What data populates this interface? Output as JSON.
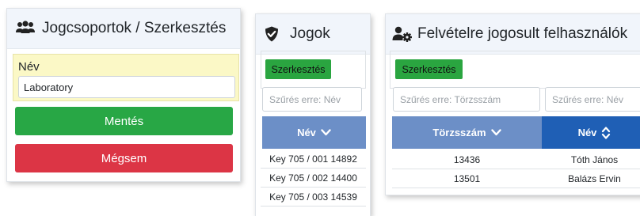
{
  "group_panel": {
    "title": "Jogcsoportok / Szerkesztés",
    "icon": "users-icon",
    "field_label": "Név",
    "field_value": "Laboratory",
    "save_label": "Mentés",
    "cancel_label": "Mégsem",
    "colors": {
      "form_bg": "#fbf8c6",
      "save": "#28a745",
      "cancel": "#dc3545"
    }
  },
  "rights_panel": {
    "title": "Jogok",
    "icon": "shield-check-icon",
    "edit_label": "Szerkesztés",
    "filter_placeholder": "Szűrés erre: Név",
    "column": "Név",
    "sort_icon": "chevron-down-icon",
    "rows": [
      "Key 705 / 001 14892",
      "Key 705 / 002 14400",
      "Key 705 / 003 14539"
    ]
  },
  "users_panel": {
    "title": "Felvételre jogosult felhasználók",
    "icon": "users-cog-icon",
    "edit_label": "Szerkesztés",
    "filter_id_placeholder": "Szűrés erre: Törzsszám",
    "filter_name_placeholder": "Szűrés erre: Név",
    "col_id": "Törzsszám",
    "col_name": "Név",
    "col_id_sort_icon": "chevron-down-icon",
    "col_name_sort_icon": "sort-icon",
    "rows": [
      {
        "id": "13436",
        "name": "Tóth János"
      },
      {
        "id": "13501",
        "name": "Balázs Ervin"
      }
    ],
    "colors": {
      "header_light": "#6c8fc7",
      "header_dark": "#1f5fb5",
      "edit_btn": "#2aa540"
    }
  }
}
